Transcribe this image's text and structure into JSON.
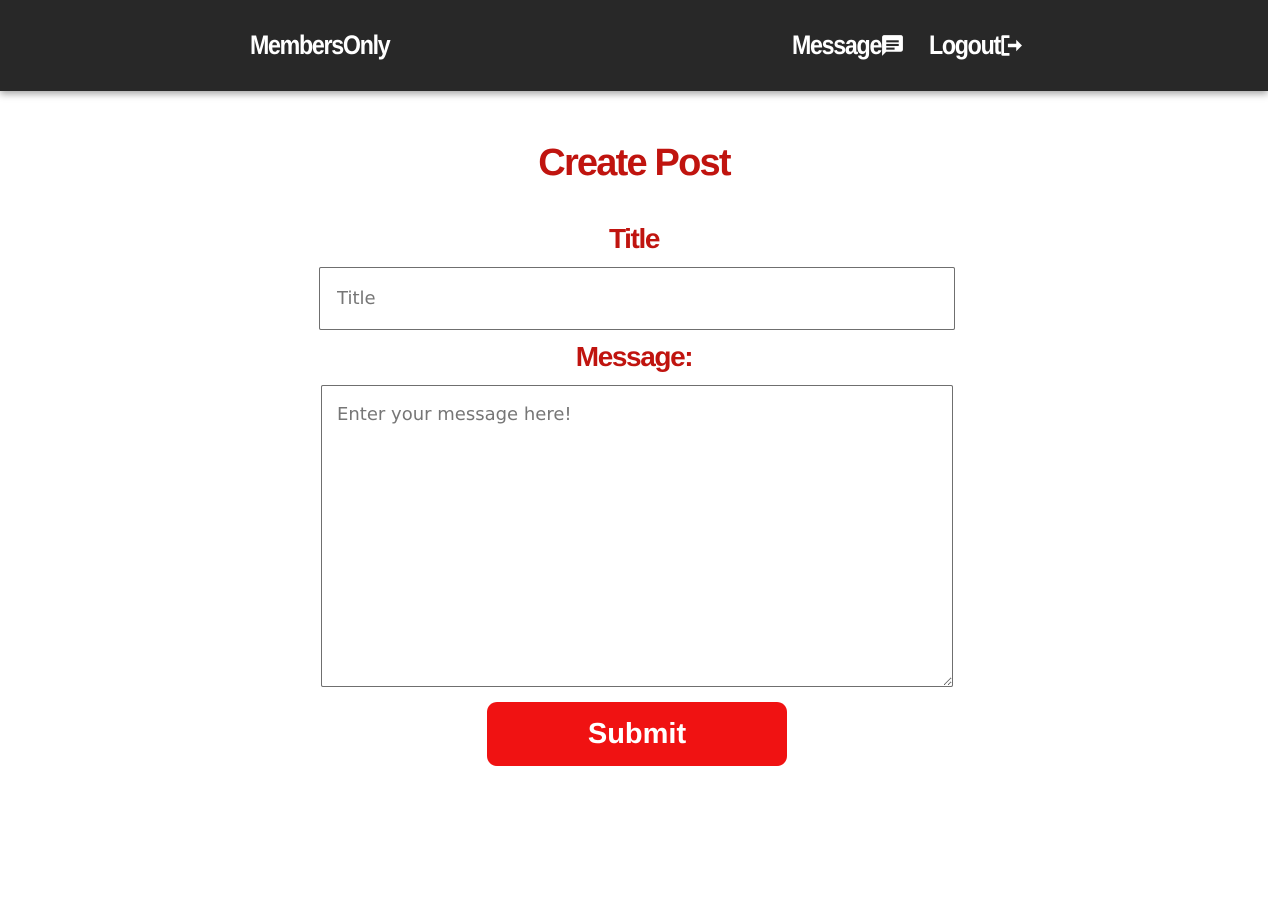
{
  "header": {
    "brand": "MembersOnly",
    "nav": {
      "message_label": "Message",
      "message_icon": "chat-icon",
      "logout_label": "Logout",
      "logout_icon": "logout-icon"
    },
    "background_color": "#282828",
    "text_color": "#ffffff"
  },
  "main": {
    "title": "Create Post",
    "form": {
      "title_label": "Title",
      "title_placeholder": "Title",
      "title_value": "",
      "message_label": "Message:",
      "message_placeholder": "Enter your message here!",
      "message_value": "",
      "submit_label": "Submit"
    },
    "accent_color": "#c0140f",
    "button_color": "#f01212"
  }
}
